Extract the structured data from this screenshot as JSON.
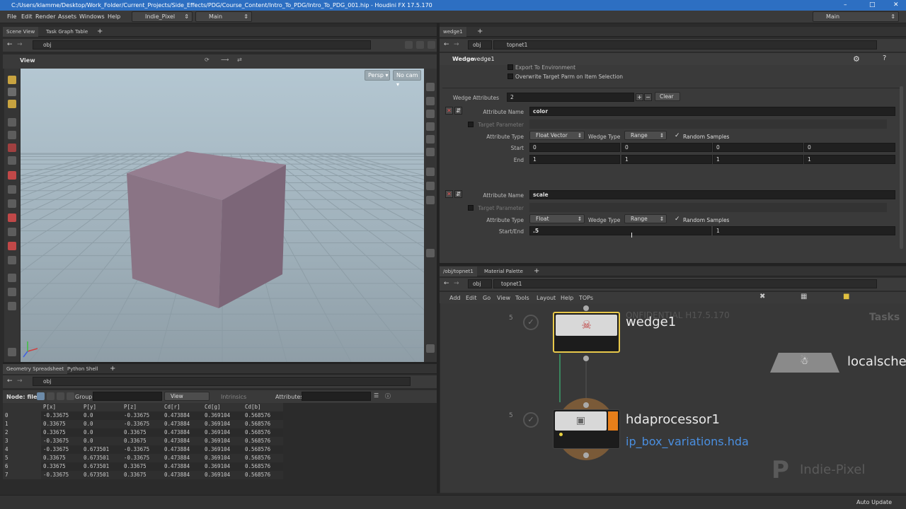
{
  "title_bar": {
    "text": "C:/Users/klamme/Desktop/Work_Folder/Current_Projects/Side_Effects/PDG/Course_Content/Intro_To_PDG/Intro_To_PDG_001.hip - Houdini FX 17.5.170"
  },
  "menu": {
    "items": [
      "File",
      "Edit",
      "Render",
      "Assets",
      "Windows",
      "Help"
    ],
    "desktop": "Indie_Pixel",
    "layout": "Main",
    "right_desktop": "Main"
  },
  "left_pane": {
    "tabs": [
      "Scene View",
      "Task Graph Table"
    ],
    "path": "obj",
    "view_label": "View",
    "persp": "Persp",
    "cam": "No cam"
  },
  "spreadsheet": {
    "tabs": [
      "Geometry Spreadsheet",
      "Python Shell"
    ],
    "path": "obj",
    "node_label": "Node: file1",
    "group_label": "Group:",
    "view_dd": "View",
    "intrinsics": "Intrinsics",
    "attributes_label": "Attributes:",
    "columns": [
      "",
      "P[x]",
      "P[y]",
      "P[z]",
      "Cd[r]",
      "Cd[g]",
      "Cd[b]"
    ],
    "rows": [
      [
        "0",
        "-0.33675",
        "0.0",
        "-0.33675",
        "0.473884",
        "0.369104",
        "0.568576"
      ],
      [
        "1",
        "0.33675",
        "0.0",
        "-0.33675",
        "0.473884",
        "0.369104",
        "0.568576"
      ],
      [
        "2",
        "0.33675",
        "0.0",
        "0.33675",
        "0.473884",
        "0.369104",
        "0.568576"
      ],
      [
        "3",
        "-0.33675",
        "0.0",
        "0.33675",
        "0.473884",
        "0.369104",
        "0.568576"
      ],
      [
        "4",
        "-0.33675",
        "0.673501",
        "-0.33675",
        "0.473884",
        "0.369104",
        "0.568576"
      ],
      [
        "5",
        "0.33675",
        "0.673501",
        "-0.33675",
        "0.473884",
        "0.369104",
        "0.568576"
      ],
      [
        "6",
        "0.33675",
        "0.673501",
        "0.33675",
        "0.473884",
        "0.369104",
        "0.568576"
      ],
      [
        "7",
        "-0.33675",
        "0.673501",
        "0.33675",
        "0.473884",
        "0.369104",
        "0.568576"
      ]
    ]
  },
  "params": {
    "tab": "wedge1",
    "path": "topnet1",
    "node_type": "Wedge",
    "node_name": "wedge1",
    "export_env": "Export To Environment",
    "overwrite": "Overwrite Target Parm on Item Selection",
    "wedge_attributes_label": "Wedge Attributes",
    "wedge_attributes_value": "2",
    "clear": "Clear",
    "attr1": {
      "name_label": "Attribute Name",
      "name": "color",
      "target_label": "Target Parameter",
      "type_label": "Attribute Type",
      "type": "Float Vector",
      "wedge_type_label": "Wedge Type",
      "wedge_type": "Range",
      "random": "Random Samples",
      "start_label": "Start",
      "start": [
        "0",
        "0",
        "0",
        "0"
      ],
      "end_label": "End",
      "end": [
        "1",
        "1",
        "1",
        "1"
      ]
    },
    "attr2": {
      "name_label": "Attribute Name",
      "name": "scale",
      "target_label": "Target Parameter",
      "type_label": "Attribute Type",
      "type": "Float",
      "wedge_type_label": "Wedge Type",
      "wedge_type": "Range",
      "random": "Random Samples",
      "startend_label": "Start/End",
      "start": ".5",
      "end": "1"
    }
  },
  "network": {
    "tabs": [
      "/obj/topnet1",
      "Material Palette"
    ],
    "path": "topnet1",
    "menu": [
      "Add",
      "Edit",
      "Go",
      "View",
      "Tools",
      "Layout",
      "Help",
      "TOPs"
    ],
    "watermark": "ONFIDENTIAL H17.5.170",
    "tasks": "Tasks",
    "nodes": [
      {
        "name": "wedge1",
        "count": "5"
      },
      {
        "name": "hdaprocessor1",
        "count": "5",
        "sub": "ip_box_variations.hda"
      },
      {
        "name": "localsche"
      }
    ],
    "brand": "Indie-Pixel"
  },
  "status": {
    "auto_update": "Auto Update"
  }
}
